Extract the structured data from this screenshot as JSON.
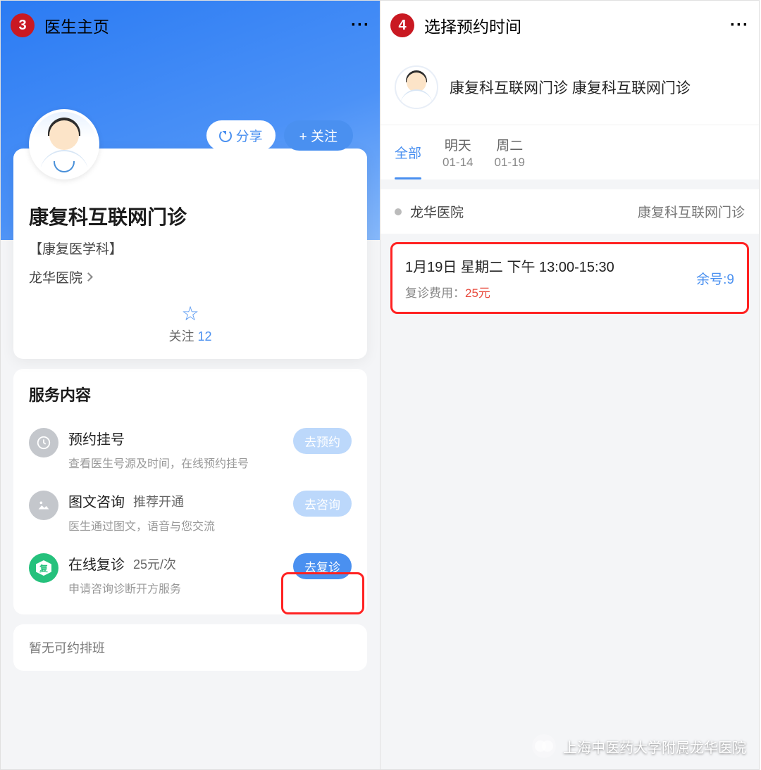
{
  "left": {
    "step": "3",
    "nav_title": "医生主页",
    "doctor_name": "康复科互联网门诊",
    "dept_tag": "【康复医学科】",
    "hospital": "龙华医院",
    "share_label": "分享",
    "follow_label": "+ 关注",
    "follow_stat_label": "关注",
    "follow_count": "12",
    "section_title": "服务内容",
    "services": [
      {
        "name": "预约挂号",
        "extra": "",
        "desc": "查看医生号源及时间，在线预约挂号",
        "btn": "去预约",
        "btn_cls": "svc-btn-light",
        "icon": "clock"
      },
      {
        "name": "图文咨询",
        "extra": "推荐开通",
        "desc": "医生通过图文，语音与您交流",
        "btn": "去咨询",
        "btn_cls": "svc-btn-light",
        "icon": "image"
      },
      {
        "name": "在线复诊",
        "extra": "25元/次",
        "desc": "申请咨询诊断开方服务",
        "btn": "去复诊",
        "btn_cls": "svc-btn-active",
        "icon": "revisit"
      }
    ],
    "empty_note": "暂无可约排班"
  },
  "right": {
    "step": "4",
    "nav_title": "选择预约时间",
    "doc_title": "康复科互联网门诊 康复科互联网门诊",
    "tabs": [
      {
        "top": "全部",
        "bot": "",
        "active": true
      },
      {
        "top": "明天",
        "bot": "01-14",
        "active": false
      },
      {
        "top": "周二",
        "bot": "01-19",
        "active": false
      }
    ],
    "loc_name": "龙华医院",
    "loc_dept": "康复科互联网门诊",
    "slot": {
      "line1": "1月19日  星期二  下午  13:00-15:30",
      "fee_label": "复诊费用：",
      "fee_value": "25元",
      "remain": "余号:9"
    }
  },
  "watermark": "上海中医药大学附属龙华医院"
}
